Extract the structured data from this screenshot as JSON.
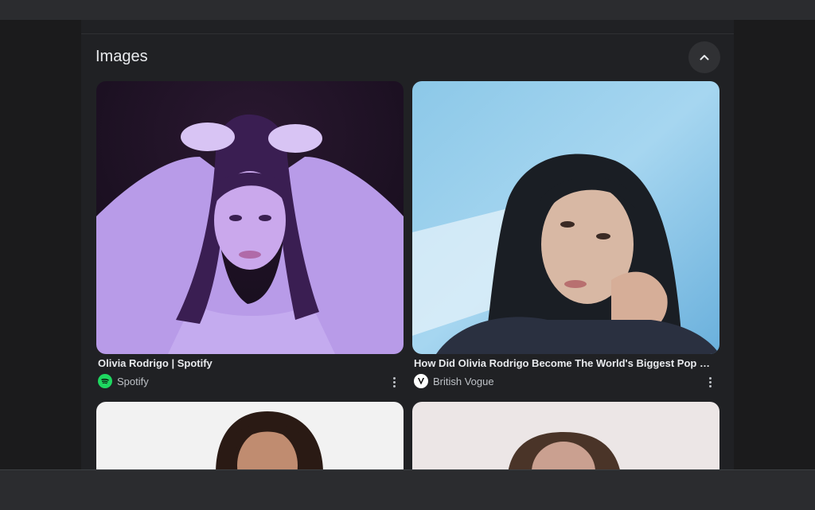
{
  "images_section": {
    "title": "Images",
    "collapse_icon": "chevron-up-icon",
    "cards": [
      {
        "title": "Olivia Rodrigo | Spotify",
        "source": "Spotify",
        "source_icon": "spotify-icon",
        "source_icon_color": "#1ed760"
      },
      {
        "title": "How Did Olivia Rodrigo Become The World's Biggest Pop Star ...",
        "source": "British Vogue",
        "source_icon": "vogue-v-icon",
        "source_icon_color": "#ffffff"
      }
    ]
  },
  "colors": {
    "page_bg": "#1b1b1c",
    "panel_bg": "#202124",
    "text_primary": "#e8eaed",
    "text_secondary": "#bdc1c6"
  }
}
